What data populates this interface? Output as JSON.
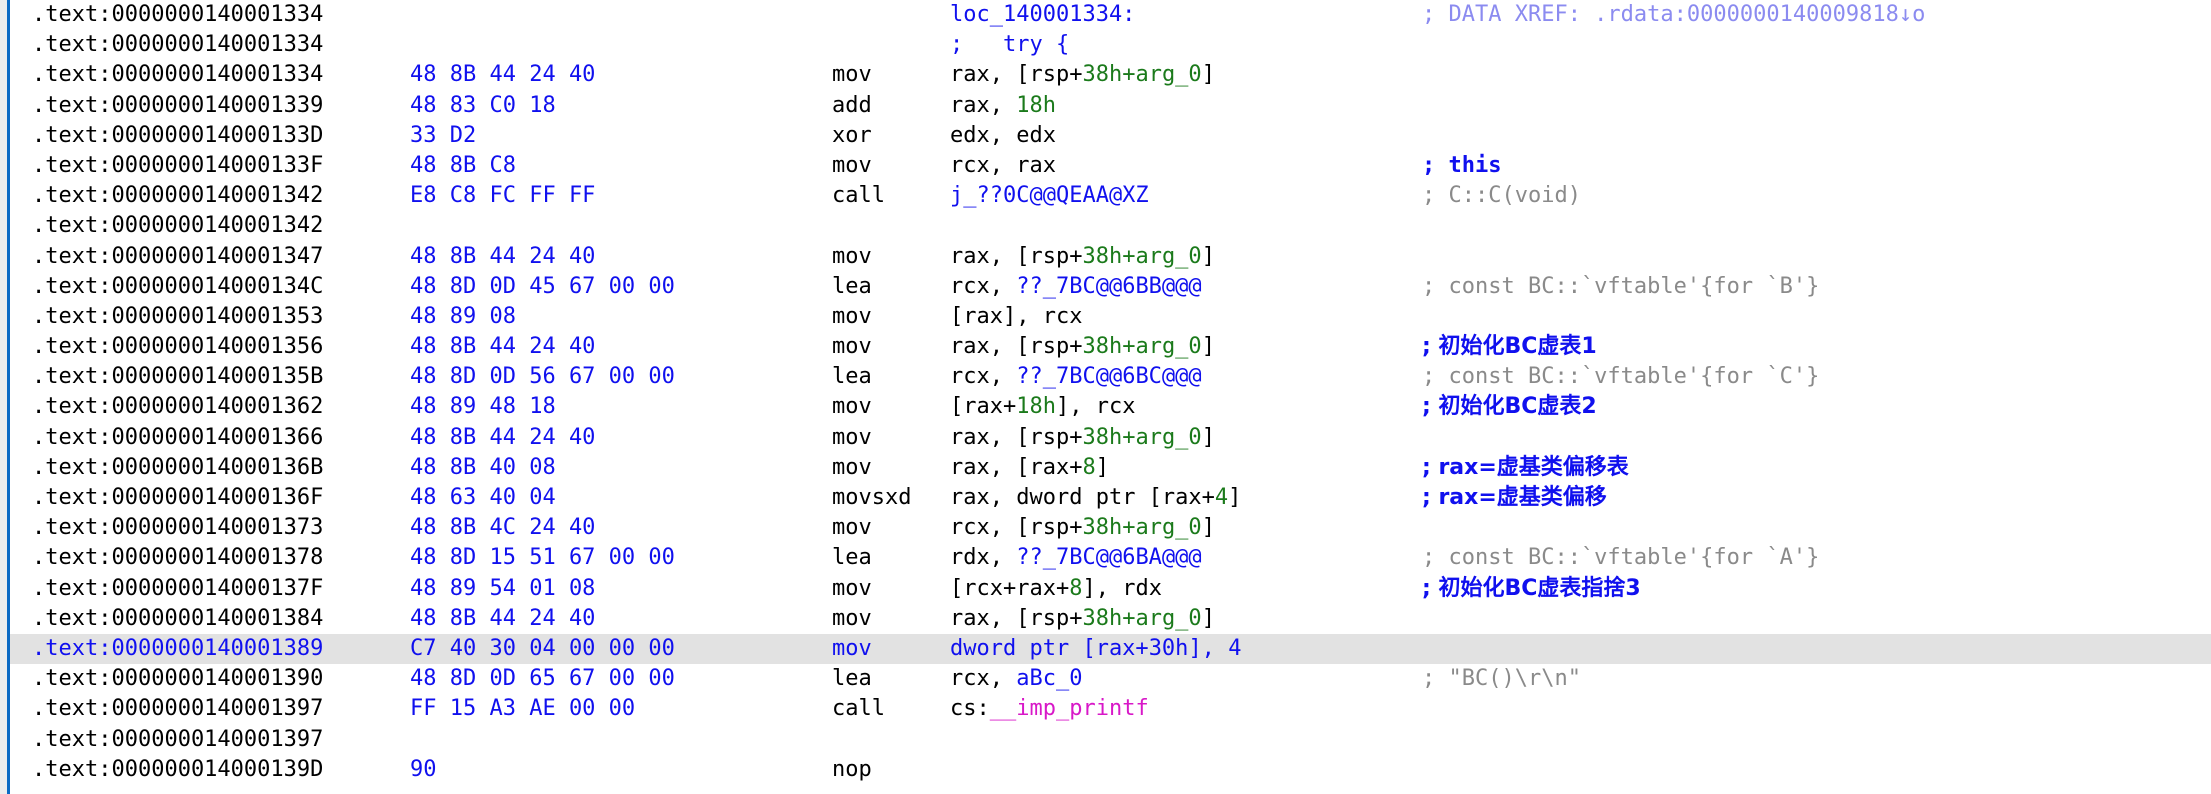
{
  "view": {
    "kind": "ida-disassembly-listing",
    "segment": ".text",
    "line_height_px": 30.2,
    "colors": {
      "background": "#ffffff",
      "panel_border": "#0b6bc4",
      "gutter_strip": "#eceeee",
      "text": "#000000",
      "hex_bytes": "#1010ee",
      "symbol": "#1010ee",
      "immediate": "#1b7a1b",
      "auto_comment": "#8a8a8a",
      "user_comment": "#1010ee",
      "xref_comment": "#8b8bf0",
      "import_symbol": "#d818c8",
      "highlight_row": "#e2e2e2"
    }
  },
  "rows": [
    {
      "addr": ".text:0000000140001334",
      "bytes": "",
      "mnem": "",
      "ops_label": "loc_140001334:",
      "comment": "; DATA XREF: .rdata:0000000140009818↓o",
      "comment_kind": "xref",
      "highlight": false
    },
    {
      "addr": ".text:0000000140001334",
      "bytes": "",
      "mnem": "",
      "ops_label": ";   try {",
      "comment": "",
      "comment_kind": "none",
      "highlight": false
    },
    {
      "addr": ".text:0000000140001334",
      "bytes": "48 8B 44 24 40",
      "mnem": "mov",
      "op_dst": "rax,",
      "op_src_pre": "[rsp+",
      "op_src_imm": "38h+arg_0",
      "op_src_post": "]",
      "comment": "",
      "comment_kind": "none",
      "highlight": false
    },
    {
      "addr": ".text:0000000140001339",
      "bytes": "48 83 C0 18",
      "mnem": "add",
      "op_dst": "rax,",
      "op_src_imm": "18h",
      "comment": "",
      "comment_kind": "none",
      "highlight": false
    },
    {
      "addr": ".text:000000014000133D",
      "bytes": "33 D2",
      "mnem": "xor",
      "op_dst": "edx,",
      "op_src": "edx",
      "comment": "",
      "comment_kind": "none",
      "highlight": false
    },
    {
      "addr": ".text:000000014000133F",
      "bytes": "48 8B C8",
      "mnem": "mov",
      "op_dst": "rcx,",
      "op_src": "rax",
      "comment": "; this",
      "comment_kind": "user",
      "highlight": false
    },
    {
      "addr": ".text:0000000140001342",
      "bytes": "E8 C8 FC FF FF",
      "mnem": "call",
      "op_sym": "j_??0C@@QEAA@XZ",
      "comment": "; C::C(void)",
      "comment_kind": "auto",
      "highlight": false
    },
    {
      "addr": ".text:0000000140001342",
      "bytes": "",
      "mnem": "",
      "comment": "",
      "comment_kind": "none",
      "highlight": false
    },
    {
      "addr": ".text:0000000140001347",
      "bytes": "48 8B 44 24 40",
      "mnem": "mov",
      "op_dst": "rax,",
      "op_src_pre": "[rsp+",
      "op_src_imm": "38h+arg_0",
      "op_src_post": "]",
      "comment": "",
      "comment_kind": "none",
      "highlight": false
    },
    {
      "addr": ".text:000000014000134C",
      "bytes": "48 8D 0D 45 67 00 00",
      "mnem": "lea",
      "op_dst": "rcx,",
      "op_sym": "??_7BC@@6BB@@@",
      "comment": "; const BC::`vftable'{for `B'}",
      "comment_kind": "auto",
      "highlight": false
    },
    {
      "addr": ".text:0000000140001353",
      "bytes": "48 89 08",
      "mnem": "mov",
      "op_dst": "[rax],",
      "op_src": "rcx",
      "comment": "",
      "comment_kind": "none",
      "highlight": false
    },
    {
      "addr": ".text:0000000140001356",
      "bytes": "48 8B 44 24 40",
      "mnem": "mov",
      "op_dst": "rax,",
      "op_src_pre": "[rsp+",
      "op_src_imm": "38h+arg_0",
      "op_src_post": "]",
      "comment": "; 初始化BC虚表1",
      "comment_kind": "user",
      "highlight": false
    },
    {
      "addr": ".text:000000014000135B",
      "bytes": "48 8D 0D 56 67 00 00",
      "mnem": "lea",
      "op_dst": "rcx,",
      "op_sym": "??_7BC@@6BC@@@",
      "comment": "; const BC::`vftable'{for `C'}",
      "comment_kind": "auto",
      "highlight": false
    },
    {
      "addr": ".text:0000000140001362",
      "bytes": "48 89 48 18",
      "mnem": "mov",
      "op_dst_pre": "[rax+",
      "op_dst_imm": "18h",
      "op_dst_post": "],",
      "op_src": "rcx",
      "comment": "; 初始化BC虚表2",
      "comment_kind": "user",
      "highlight": false
    },
    {
      "addr": ".text:0000000140001366",
      "bytes": "48 8B 44 24 40",
      "mnem": "mov",
      "op_dst": "rax,",
      "op_src_pre": "[rsp+",
      "op_src_imm": "38h+arg_0",
      "op_src_post": "]",
      "comment": "",
      "comment_kind": "none",
      "highlight": false
    },
    {
      "addr": ".text:000000014000136B",
      "bytes": "48 8B 40 08",
      "mnem": "mov",
      "op_dst": "rax,",
      "op_src_pre": "[rax+",
      "op_src_imm": "8",
      "op_src_post": "]",
      "comment": "; rax=虚基类偏移表",
      "comment_kind": "user",
      "highlight": false
    },
    {
      "addr": ".text:000000014000136F",
      "bytes": "48 63 40 04",
      "mnem": "movsxd",
      "op_dst": "rax,",
      "op_src_pre": "dword ptr [rax+",
      "op_src_imm": "4",
      "op_src_post": "]",
      "comment": "; rax=虚基类偏移",
      "comment_kind": "user",
      "highlight": false
    },
    {
      "addr": ".text:0000000140001373",
      "bytes": "48 8B 4C 24 40",
      "mnem": "mov",
      "op_dst": "rcx,",
      "op_src_pre": "[rsp+",
      "op_src_imm": "38h+arg_0",
      "op_src_post": "]",
      "comment": "",
      "comment_kind": "none",
      "highlight": false
    },
    {
      "addr": ".text:0000000140001378",
      "bytes": "48 8D 15 51 67 00 00",
      "mnem": "lea",
      "op_dst": "rdx,",
      "op_sym": "??_7BC@@6BA@@@",
      "comment": "; const BC::`vftable'{for `A'}",
      "comment_kind": "auto",
      "highlight": false
    },
    {
      "addr": ".text:000000014000137F",
      "bytes": "48 89 54 01 08",
      "mnem": "mov",
      "op_dst_pre": "[rcx+rax+",
      "op_dst_imm": "8",
      "op_dst_post": "],",
      "op_src": "rdx",
      "comment": "; 初始化BC虚表指捨3",
      "comment_kind": "user",
      "highlight": false
    },
    {
      "addr": ".text:0000000140001384",
      "bytes": "48 8B 44 24 40",
      "mnem": "mov",
      "op_dst": "rax,",
      "op_src_pre": "[rsp+",
      "op_src_imm": "38h+arg_0",
      "op_src_post": "]",
      "comment": "",
      "comment_kind": "none",
      "highlight": false
    },
    {
      "addr": ".text:0000000140001389",
      "bytes": "C7 40 30 04 00 00 00",
      "mnem": "mov",
      "op_dst_pre": "dword ptr [rax+",
      "op_dst_imm": "30h",
      "op_dst_post": "],",
      "op_src_imm": "4",
      "comment": "",
      "comment_kind": "none",
      "highlight": true
    },
    {
      "addr": ".text:0000000140001390",
      "bytes": "48 8D 0D 65 67 00 00",
      "mnem": "lea",
      "op_dst": "rcx,",
      "op_sym": "aBc_0",
      "comment": "; \"BC()\\r\\n\"",
      "comment_kind": "auto",
      "highlight": false
    },
    {
      "addr": ".text:0000000140001397",
      "bytes": "FF 15 A3 AE 00 00",
      "mnem": "call",
      "op_dst": "cs:",
      "op_imp": "__imp_printf",
      "comment": "",
      "comment_kind": "none",
      "highlight": false
    },
    {
      "addr": ".text:0000000140001397",
      "bytes": "",
      "mnem": "",
      "comment": "",
      "comment_kind": "none",
      "highlight": false
    },
    {
      "addr": ".text:000000014000139D",
      "bytes": "90",
      "mnem": "nop",
      "comment": "",
      "comment_kind": "none",
      "highlight": false
    }
  ]
}
